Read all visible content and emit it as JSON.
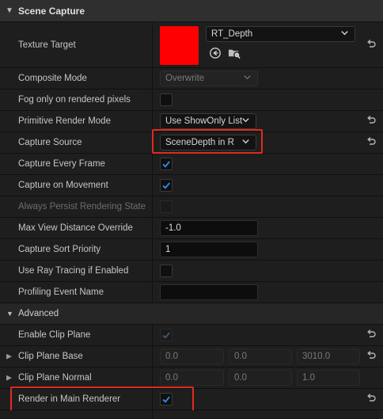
{
  "section_header": {
    "title": "Scene Capture"
  },
  "texture_target": {
    "label": "Texture Target",
    "swatch_color": "#ff0000",
    "asset_name": "RT_Depth",
    "browse_icon": "arrow-left-circle-icon",
    "find_icon": "folder-search-icon"
  },
  "composite_mode": {
    "label": "Composite Mode",
    "value": "Overwrite"
  },
  "fog_only": {
    "label": "Fog only on rendered pixels",
    "checked": false
  },
  "primitive_render_mode": {
    "label": "Primitive Render Mode",
    "value": "Use ShowOnly List"
  },
  "capture_source": {
    "label": "Capture Source",
    "value": "SceneDepth in R"
  },
  "capture_every_frame": {
    "label": "Capture Every Frame",
    "checked": true
  },
  "capture_on_movement": {
    "label": "Capture on Movement",
    "checked": true
  },
  "always_persist": {
    "label": "Always Persist Rendering State",
    "checked": false
  },
  "max_view_distance": {
    "label": "Max View Distance Override",
    "value": "-1.0"
  },
  "capture_sort_priority": {
    "label": "Capture Sort Priority",
    "value": "1"
  },
  "use_ray_tracing": {
    "label": "Use Ray Tracing if Enabled",
    "checked": false
  },
  "profiling_event_name": {
    "label": "Profiling Event Name",
    "value": ""
  },
  "advanced": {
    "title": "Advanced"
  },
  "enable_clip_plane": {
    "label": "Enable Clip Plane",
    "checked": true
  },
  "clip_plane_base": {
    "label": "Clip Plane Base",
    "x": "0.0",
    "y": "0.0",
    "z": "3010.0"
  },
  "clip_plane_normal": {
    "label": "Clip Plane Normal",
    "x": "0.0",
    "y": "0.0",
    "z": "1.0"
  },
  "render_in_main": {
    "label": "Render in Main Renderer",
    "checked": true
  },
  "colors": {
    "highlight": "#e02a1e",
    "checkbox_check": "#2f88e0"
  }
}
